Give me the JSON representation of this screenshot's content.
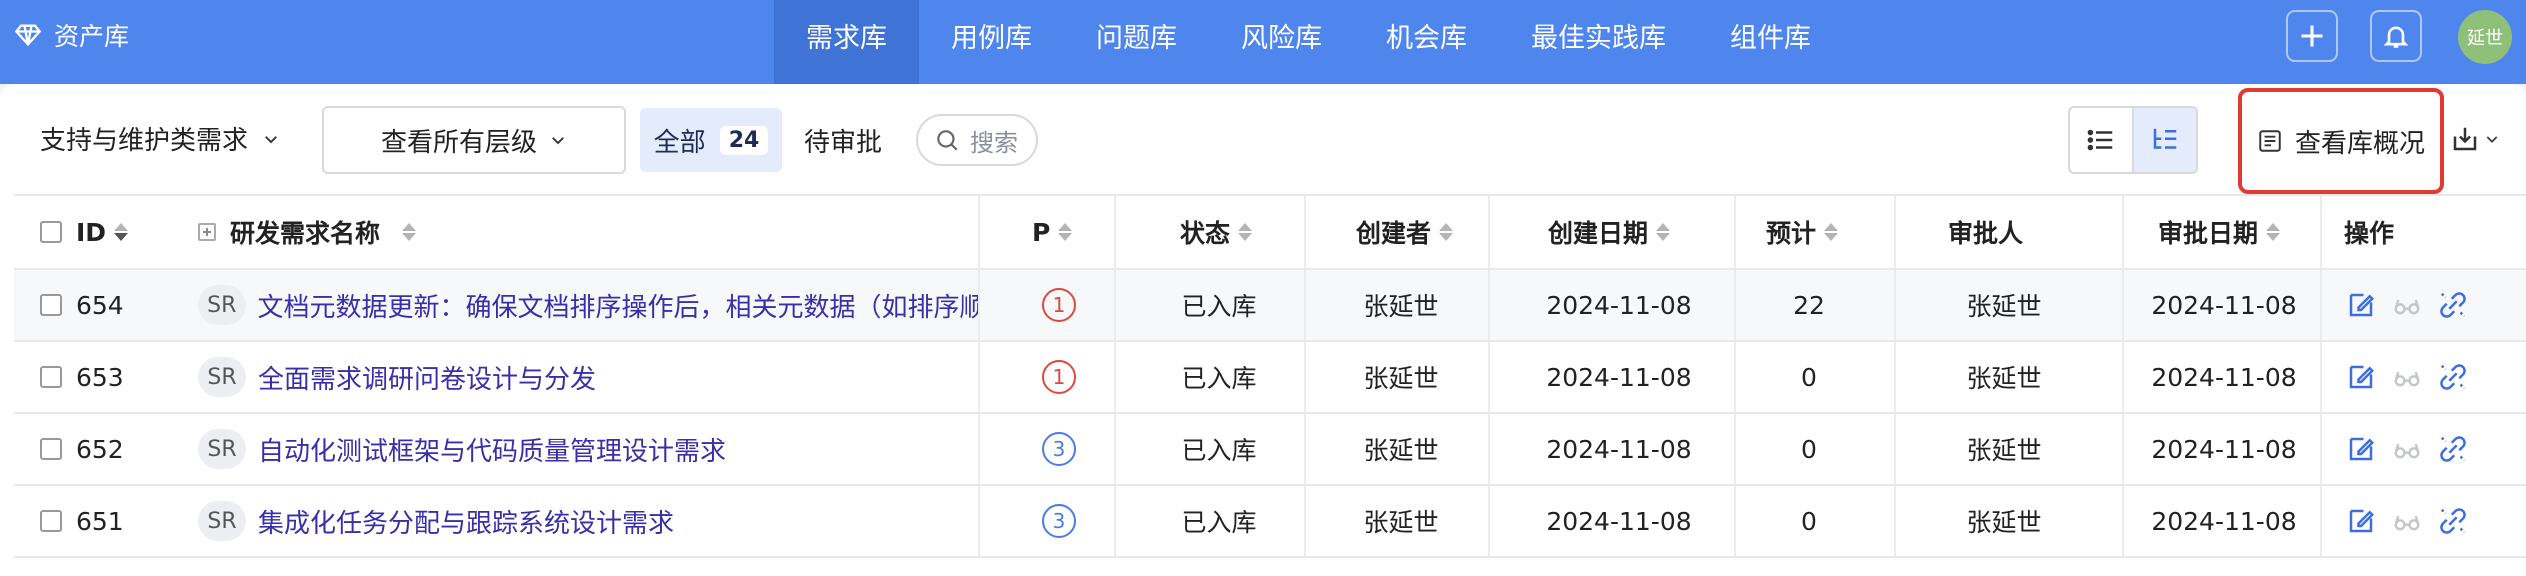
{
  "brand": {
    "title": "资产库"
  },
  "nav": {
    "tabs": [
      {
        "label": "需求库",
        "active": true
      },
      {
        "label": "用例库",
        "active": false
      },
      {
        "label": "问题库",
        "active": false
      },
      {
        "label": "风险库",
        "active": false
      },
      {
        "label": "机会库",
        "active": false
      },
      {
        "label": "最佳实践库",
        "active": false
      },
      {
        "label": "组件库",
        "active": false
      }
    ],
    "user_avatar": "延世",
    "icons": [
      "plus-icon",
      "bell-icon"
    ]
  },
  "toolbar": {
    "type_filter": "支持与维护类需求",
    "level_select": "查看所有层级",
    "tab_all_label": "全部",
    "tab_all_count": "24",
    "tab_pending_label": "待审批",
    "search_placeholder": "搜索",
    "overview_label": "查看库概况"
  },
  "table": {
    "headers": {
      "id": "ID",
      "name": "研发需求名称",
      "priority": "P",
      "status": "状态",
      "creator": "创建者",
      "created": "创建日期",
      "estimate": "预计",
      "approver": "审批人",
      "approved": "审批日期",
      "ops": "操作"
    },
    "rows": [
      {
        "id": "654",
        "tag": "SR",
        "name": "文档元数据更新：确保文档排序操作后，相关元数据（如排序顺",
        "priority": "1",
        "status": "已入库",
        "creator": "张延世",
        "created": "2024-11-08",
        "estimate": "22",
        "approver": "张延世",
        "approved": "2024-11-08"
      },
      {
        "id": "653",
        "tag": "SR",
        "name": "全面需求调研问卷设计与分发",
        "priority": "1",
        "status": "已入库",
        "creator": "张延世",
        "created": "2024-11-08",
        "estimate": "0",
        "approver": "张延世",
        "approved": "2024-11-08"
      },
      {
        "id": "652",
        "tag": "SR",
        "name": "自动化测试框架与代码质量管理设计需求",
        "priority": "3",
        "status": "已入库",
        "creator": "张延世",
        "created": "2024-11-08",
        "estimate": "0",
        "approver": "张延世",
        "approved": "2024-11-08"
      },
      {
        "id": "651",
        "tag": "SR",
        "name": "集成化任务分配与跟踪系统设计需求",
        "priority": "3",
        "status": "已入库",
        "creator": "张延世",
        "created": "2024-11-08",
        "estimate": "0",
        "approver": "张延世",
        "approved": "2024-11-08"
      }
    ]
  },
  "colors": {
    "nav_bg": "#4f86ee",
    "nav_active": "#3f73d6",
    "link": "#3a2fa8",
    "priority_high": "#e0483c",
    "priority_low": "#4a7be6",
    "highlight_border": "#e23a33"
  }
}
